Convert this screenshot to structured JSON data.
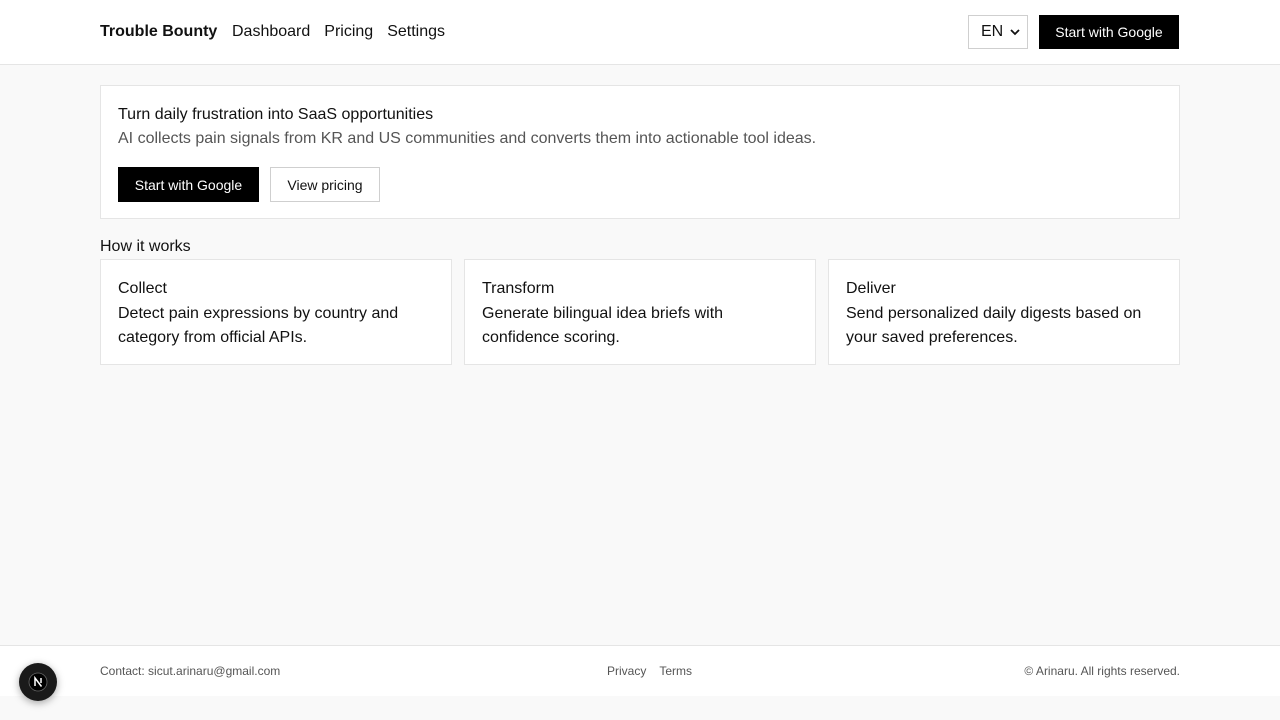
{
  "header": {
    "brand": "Trouble Bounty",
    "nav": [
      "Dashboard",
      "Pricing",
      "Settings"
    ],
    "language": "EN",
    "cta_label": "Start with Google"
  },
  "hero": {
    "title": "Turn daily frustration into SaaS opportunities",
    "subtitle": "AI collects pain signals from KR and US communities and converts them into actionable tool ideas.",
    "primary_label": "Start with Google",
    "secondary_label": "View pricing"
  },
  "how": {
    "title": "How it works",
    "cards": [
      {
        "title": "Collect",
        "desc": "Detect pain expressions by country and category from official APIs."
      },
      {
        "title": "Transform",
        "desc": "Generate bilingual idea briefs with confidence scoring."
      },
      {
        "title": "Deliver",
        "desc": "Send personalized daily digests based on your saved preferences."
      }
    ]
  },
  "footer": {
    "contact": "Contact: sicut.arinaru@gmail.com",
    "links": [
      "Privacy",
      "Terms"
    ],
    "copyright": "© Arinaru. All rights reserved."
  },
  "dev_badge": {
    "icon": "nextjs-icon"
  },
  "colors": {
    "accent": "#000000",
    "background": "#f9f9f9",
    "border": "#e5e5e5",
    "muted_text": "#555555"
  }
}
